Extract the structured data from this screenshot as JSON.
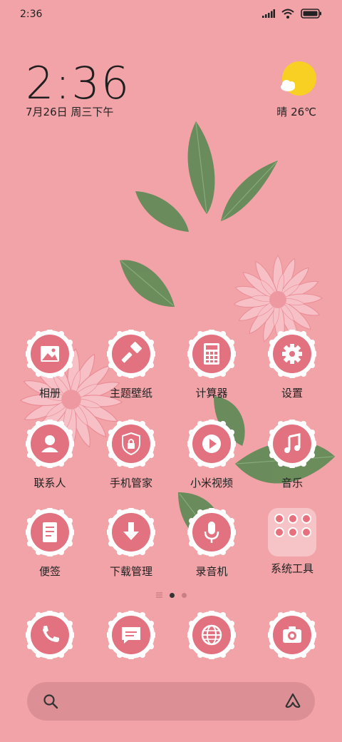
{
  "status": {
    "time": "2:36"
  },
  "clock": {
    "time": "2:36",
    "date": "7月26日 周三下午"
  },
  "weather": {
    "text": "晴 26℃",
    "icon": "sun-cloud-icon"
  },
  "apps": [
    {
      "label": "相册",
      "icon": "gallery-icon"
    },
    {
      "label": "主题壁纸",
      "icon": "brush-icon"
    },
    {
      "label": "计算器",
      "icon": "calculator-icon"
    },
    {
      "label": "设置",
      "icon": "gear-icon"
    },
    {
      "label": "联系人",
      "icon": "contact-icon"
    },
    {
      "label": "手机管家",
      "icon": "shield-icon"
    },
    {
      "label": "小米视频",
      "icon": "play-icon"
    },
    {
      "label": "音乐",
      "icon": "music-icon"
    },
    {
      "label": "便签",
      "icon": "note-icon"
    },
    {
      "label": "下载管理",
      "icon": "download-icon"
    },
    {
      "label": "录音机",
      "icon": "mic-icon"
    },
    {
      "label": "系统工具",
      "icon": "folder-icon"
    }
  ],
  "dock": [
    {
      "name": "phone",
      "icon": "phone-icon"
    },
    {
      "name": "messages",
      "icon": "message-icon"
    },
    {
      "name": "browser",
      "icon": "globe-icon"
    },
    {
      "name": "camera",
      "icon": "camera-icon"
    }
  ],
  "pages": {
    "count": 2,
    "current": 1
  },
  "colors": {
    "background": "#f2a3a8",
    "icon_fill": "#e2727f",
    "leaf": "#5f8a55",
    "petal": "#f6c0c6"
  }
}
